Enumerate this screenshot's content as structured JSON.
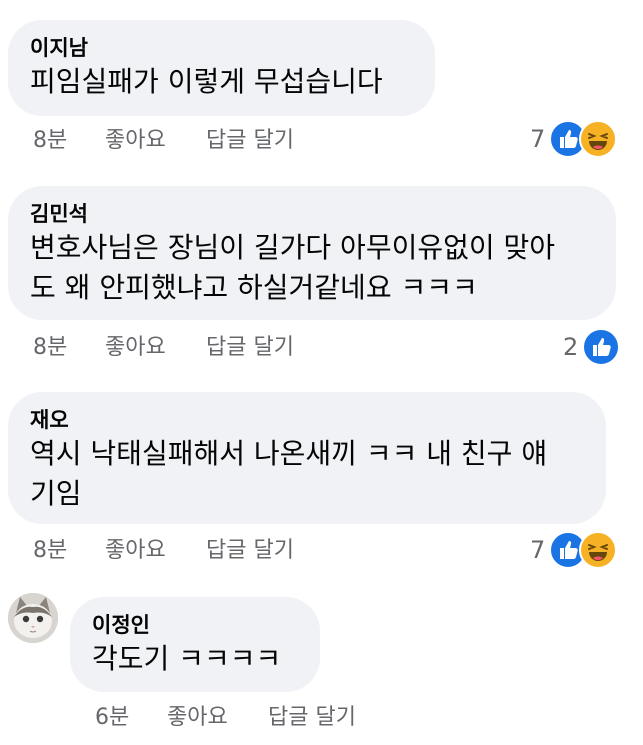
{
  "comments": [
    {
      "author": "이지남",
      "text": "피임실패가 이렇게 무섭습니다",
      "time": "8분",
      "like_label": "좋아요",
      "reply_label": "답글 달기",
      "reaction_count": "7",
      "reactions": [
        "like-icon",
        "haha-icon"
      ]
    },
    {
      "author": "김민석",
      "text": "변호사님은 장님이 길가다 아무이유없이 맞아\n도 왜 안피했냐고 하실거같네요 ㅋㅋㅋ",
      "time": "8분",
      "like_label": "좋아요",
      "reply_label": "답글 달기",
      "reaction_count": "2",
      "reactions": [
        "like-icon"
      ]
    },
    {
      "author": "재오",
      "text": "역시 낙태실패해서 나온새끼 ㅋㅋ 내 친구 얘\n기임",
      "time": "8분",
      "like_label": "좋아요",
      "reply_label": "답글 달기",
      "reaction_count": "7",
      "reactions": [
        "like-icon",
        "haha-icon"
      ]
    },
    {
      "author": "이정인",
      "text": "각도기 ㅋㅋㅋㅋ",
      "time": "6분",
      "like_label": "좋아요",
      "reply_label": "답글 달기",
      "avatar": "cat-avatar"
    }
  ],
  "colors": {
    "bubble": "#f0f2f5",
    "meta_text": "#65676b",
    "like_blue": "#1b74e4",
    "haha_yellow": "#f7b125"
  }
}
